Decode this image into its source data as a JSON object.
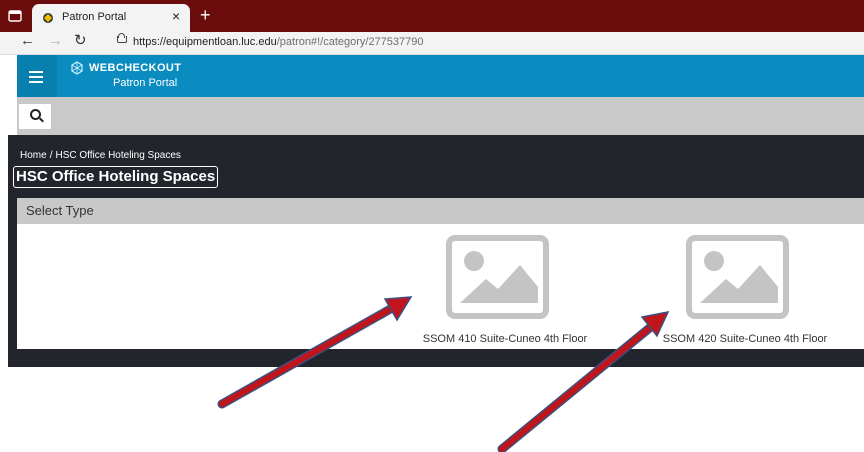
{
  "browser": {
    "tab_title": "Patron Portal",
    "tab_close": "×",
    "new_tab": "+",
    "url_host": "https://equipmentloan.luc.edu",
    "url_path": "/patron#!/category/277537790"
  },
  "app": {
    "brand": "WEBCHECKOUT",
    "subtitle": "Patron Portal"
  },
  "breadcrumb": {
    "home": "Home",
    "separator": "/",
    "current": "HSC Office Hoteling Spaces"
  },
  "page": {
    "title": "HSC Office Hoteling Spaces",
    "panel_header": "Select Type"
  },
  "items": [
    {
      "label": "SSOM 410 Suite-Cuneo 4th Floor"
    },
    {
      "label": "SSOM 420 Suite-Cuneo 4th Floor"
    }
  ],
  "colors": {
    "tab_strip": "#6b0c0c",
    "header_blue": "#0b8cc0",
    "content_dark": "#22252c",
    "arrow_red": "#c0151b",
    "arrow_outline": "#3c4f80"
  }
}
